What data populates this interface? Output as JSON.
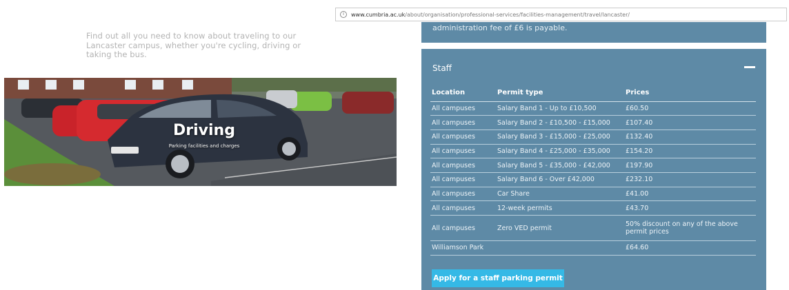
{
  "address_bar": {
    "host": "www.cumbria.ac.uk",
    "path": "/about/organisation/professional-services/facilities-management/travel/lancaster/"
  },
  "intro": {
    "text": "Find out all you need to know about traveling to our Lancaster campus, whether you're cycling, driving or taking the bus."
  },
  "hero": {
    "title": "Driving",
    "subtitle": "Parking facilities and charges"
  },
  "admin_box": {
    "text": "administration fee of £6 is payable."
  },
  "staff": {
    "header": "Staff",
    "columns": [
      "Location",
      "Permit type",
      "Prices"
    ],
    "rows": [
      {
        "location": "All campuses",
        "permit": "Salary Band 1 - Up to £10,500",
        "price": "£60.50"
      },
      {
        "location": "All campuses",
        "permit": "Salary Band 2 - £10,500 - £15,000",
        "price": "£107.40"
      },
      {
        "location": "All campuses",
        "permit": "Salary Band 3 - £15,000 - £25,000",
        "price": "£132.40"
      },
      {
        "location": "All campuses",
        "permit": "Salary Band 4 - £25,000 - £35,000",
        "price": "£154.20"
      },
      {
        "location": "All campuses",
        "permit": "Salary Band 5 - £35,000 - £42,000",
        "price": "£197.90"
      },
      {
        "location": "All campuses",
        "permit": "Salary Band 6 - Over £42,000",
        "price": "£232.10"
      },
      {
        "location": "All campuses",
        "permit": "Car Share",
        "price": "£41.00"
      },
      {
        "location": "All campuses",
        "permit": "12-week permits",
        "price": "£43.70"
      },
      {
        "location": "All campuses",
        "permit": "Zero VED permit",
        "price": "50% discount on any of the above permit prices"
      },
      {
        "location": "Williamson Park",
        "permit": "",
        "price": "£64.60"
      }
    ],
    "apply_button": "Apply for a staff parking permit"
  },
  "colors": {
    "panel": "#5e8aa6",
    "button": "#35b9e6",
    "intro_text": "#b3b3b3"
  }
}
